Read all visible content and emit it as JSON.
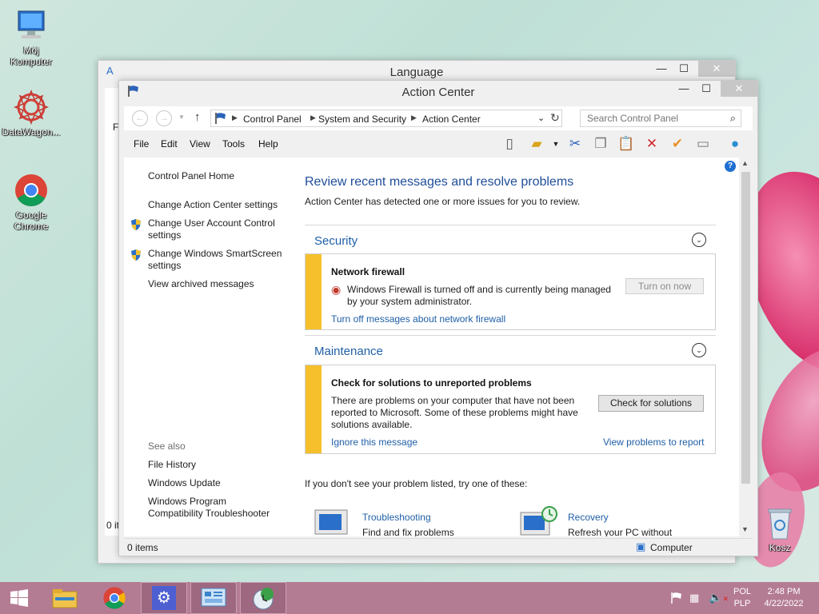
{
  "desktop": {
    "icons": [
      {
        "label": "Mój\nKomputer",
        "icon": "computer-icon"
      },
      {
        "label": "DataWagon...",
        "icon": "datawagon-icon"
      },
      {
        "label": "Google\nChrome",
        "icon": "chrome-icon"
      },
      {
        "label": "Kosz",
        "icon": "recycle-bin-icon"
      }
    ]
  },
  "language_window": {
    "title": "Language",
    "partial_text_1": "Fi",
    "partial_text_2": "0 it"
  },
  "action_center": {
    "title": "Action Center",
    "breadcrumb": [
      "Control Panel",
      "System and Security",
      "Action Center"
    ],
    "search_placeholder": "Search Control Panel",
    "menu": [
      "File",
      "Edit",
      "View",
      "Tools",
      "Help"
    ],
    "sidebar": {
      "home": "Control Panel Home",
      "links": [
        "Change Action Center settings",
        "Change User Account Control settings",
        "Change Windows SmartScreen settings",
        "View archived messages"
      ],
      "see_also_heading": "See also",
      "see_also": [
        "File History",
        "Windows Update",
        "Windows Program Compatibility Troubleshooter"
      ]
    },
    "main": {
      "heading": "Review recent messages and resolve problems",
      "subheading": "Action Center has detected one or more issues for you to review.",
      "security": {
        "title": "Security",
        "card_title": "Network firewall",
        "card_text": "Windows Firewall is turned off and is currently being managed by your system administrator.",
        "button": "Turn on now",
        "link": "Turn off messages about network firewall"
      },
      "maintenance": {
        "title": "Maintenance",
        "card_title": "Check for solutions to unreported problems",
        "card_text": "There are problems on your computer that have not been reported to Microsoft. Some of these problems might have solutions available.",
        "button": "Check for solutions",
        "link_ignore": "Ignore this message",
        "link_view": "View problems to report"
      },
      "footer_text": "If you don't see your problem listed, try one of these:",
      "troubleshooting": {
        "title": "Troubleshooting",
        "desc": "Find and fix problems"
      },
      "recovery": {
        "title": "Recovery",
        "desc": "Refresh your PC without"
      }
    },
    "status": {
      "items": "0 items",
      "location": "Computer"
    }
  },
  "taskbar": {
    "lang_1": "POL",
    "lang_2": "PLP",
    "time": "2:48 PM",
    "date": "4/22/2022"
  }
}
